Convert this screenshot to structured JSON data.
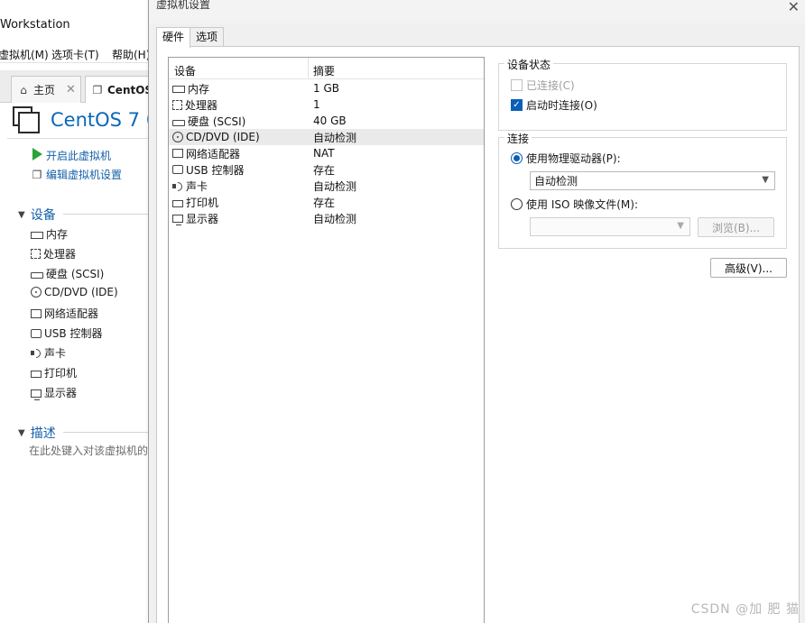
{
  "background_app": {
    "title": "Workstation",
    "menu": [
      "虚拟机(M)",
      "选项卡(T)",
      "帮助(H)"
    ],
    "tabs": [
      {
        "label": "主页",
        "icon": "home-icon"
      },
      {
        "label": "CentOS",
        "icon": "vm-icon"
      }
    ],
    "vm_name": "CentOS 7 6",
    "actions": [
      "开启此虚拟机",
      "编辑虚拟机设置"
    ],
    "devices_section": "设备",
    "devices": [
      "内存",
      "处理器",
      "硬盘 (SCSI)",
      "CD/DVD (IDE)",
      "网络适配器",
      "USB 控制器",
      "声卡",
      "打印机",
      "显示器"
    ],
    "description_section": "描述",
    "description_hint": "在此处键入对该虚拟机的"
  },
  "dialog": {
    "title": "虚拟机设置",
    "tabs": [
      "硬件",
      "选项"
    ],
    "device_list": {
      "headers": [
        "设备",
        "摘要"
      ],
      "rows": [
        {
          "name": "内存",
          "summary": "1 GB",
          "icon": "memory-icon"
        },
        {
          "name": "处理器",
          "summary": "1",
          "icon": "cpu-icon"
        },
        {
          "name": "硬盘 (SCSI)",
          "summary": "40 GB",
          "icon": "hard-disk-icon"
        },
        {
          "name": "CD/DVD (IDE)",
          "summary": "自动检测",
          "icon": "cd-dvd-icon"
        },
        {
          "name": "网络适配器",
          "summary": "NAT",
          "icon": "network-adapter-icon"
        },
        {
          "name": "USB 控制器",
          "summary": "存在",
          "icon": "usb-icon"
        },
        {
          "name": "声卡",
          "summary": "自动检测",
          "icon": "sound-card-icon"
        },
        {
          "name": "打印机",
          "summary": "存在",
          "icon": "printer-icon"
        },
        {
          "name": "显示器",
          "summary": "自动检测",
          "icon": "monitor-icon"
        }
      ]
    },
    "device_status": {
      "label": "设备状态",
      "connected": "已连接(C)",
      "connect_at_power_on": "启动时连接(O)"
    },
    "connection": {
      "label": "连接",
      "physical_drive": "使用物理驱动器(P):",
      "physical_drive_value": "自动检测",
      "iso_image": "使用 ISO 映像文件(M):",
      "iso_value": "",
      "browse": "浏览(B)..."
    },
    "advanced": "高级(V)..."
  },
  "watermark": "CSDN @加 肥 猫",
  "colors": {
    "accent": "#0a5fb6",
    "link": "#1560a8",
    "play": "#2aa33a"
  }
}
